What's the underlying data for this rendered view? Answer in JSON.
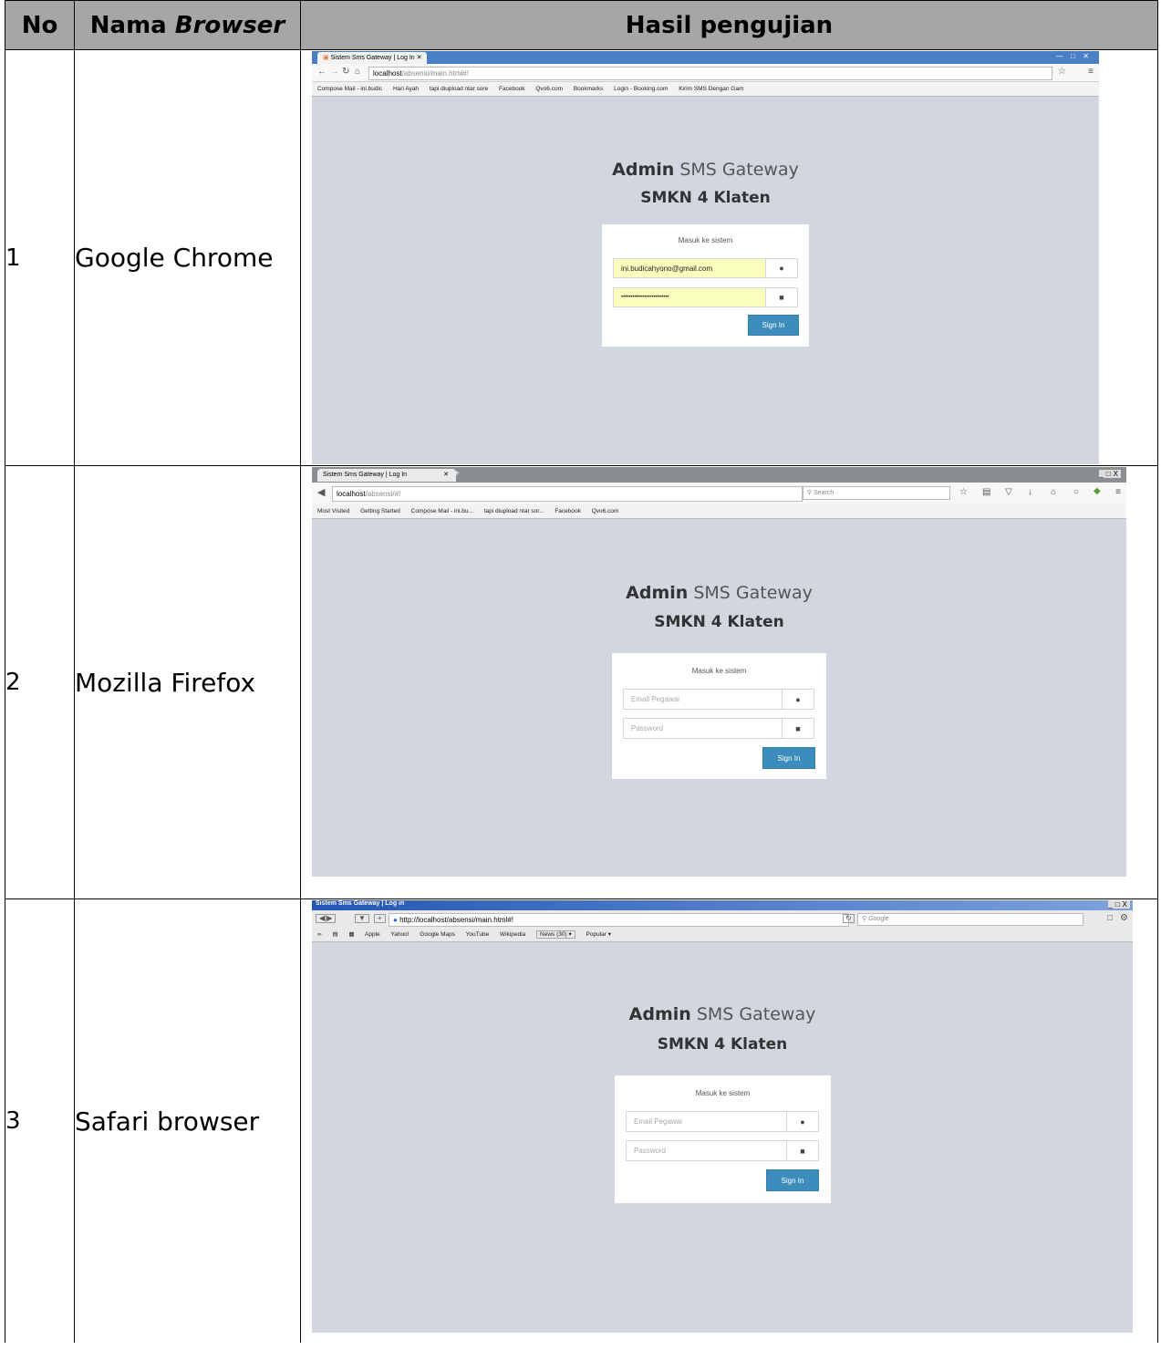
{
  "table": {
    "header": {
      "no": "No",
      "name_prefix": "Nama ",
      "name_italic": "Browser",
      "result": "Hasil pengujian"
    },
    "rows": [
      {
        "no": "1",
        "name": "Google Chrome"
      },
      {
        "no": "2",
        "name": "Mozilla Firefox"
      },
      {
        "no": "3",
        "name": "Safari browser"
      }
    ]
  },
  "login": {
    "title_bold": "Admin",
    "title_light": " SMS Gateway",
    "subtitle": "SMKN 4 Klaten",
    "message": "Masuk ke sistem",
    "email_placeholder": "Email Pegawai",
    "password_placeholder": "Password",
    "sign_in": "Sign In"
  },
  "chrome": {
    "tab_title": "Sistem Sms Gateway | Log In",
    "url_host": "localhost",
    "url_path": "/absensi/main.html#!",
    "email_value": "ini.budicahyono@gmail.com",
    "password_value": "•••••••••••••••••••••••••",
    "bookmarks": [
      "Compose Mail - ini.budic",
      "Hari Ayah",
      "tapi diupload ntar sore",
      "Facebook",
      "Qvo6.com",
      "Bookmarks",
      "Login - Booking.com",
      "Kirim SMS Dengan Gam"
    ]
  },
  "firefox": {
    "tab_title": "Sistem Sms Gateway | Log In",
    "url_host": "localhost",
    "url_path": "/absensi/#!",
    "search_placeholder": "Search",
    "bookmarks": [
      "Most Visited",
      "Getting Started",
      "Compose Mail - ini.bu...",
      "tapi diupload ntar sor...",
      "Facebook",
      "Qvo6.com"
    ]
  },
  "safari": {
    "window_title": "Sistem Sms Gateway | Log in",
    "url": "http://localhost/absensi/main.html#!",
    "search_placeholder": "Google",
    "bookmarks": [
      "Apple",
      "Yahoo!",
      "Google Maps",
      "YouTube",
      "Wikipedia",
      "News (30) ▾",
      "Popular ▾"
    ]
  }
}
